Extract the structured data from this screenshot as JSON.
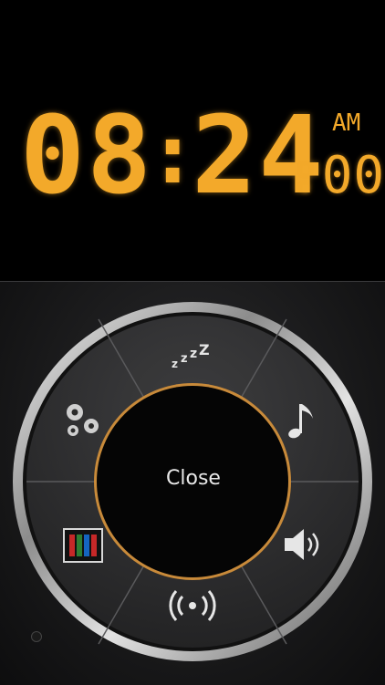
{
  "clock": {
    "hours": "08",
    "minutes": "24",
    "seconds": "00",
    "separator": ":",
    "period": "AM",
    "color": "#f3a92a"
  },
  "menu": {
    "center_label": "Close",
    "segments": [
      {
        "id": "snooze",
        "icon": "snooze-zzz-icon",
        "glyph": "zᶻᶻZ"
      },
      {
        "id": "music",
        "icon": "music-note-icon"
      },
      {
        "id": "volume",
        "icon": "speaker-volume-icon"
      },
      {
        "id": "broadcast",
        "icon": "wireless-broadcast-icon"
      },
      {
        "id": "theme",
        "icon": "color-bars-icon"
      },
      {
        "id": "settings",
        "icon": "gears-icon"
      }
    ]
  }
}
